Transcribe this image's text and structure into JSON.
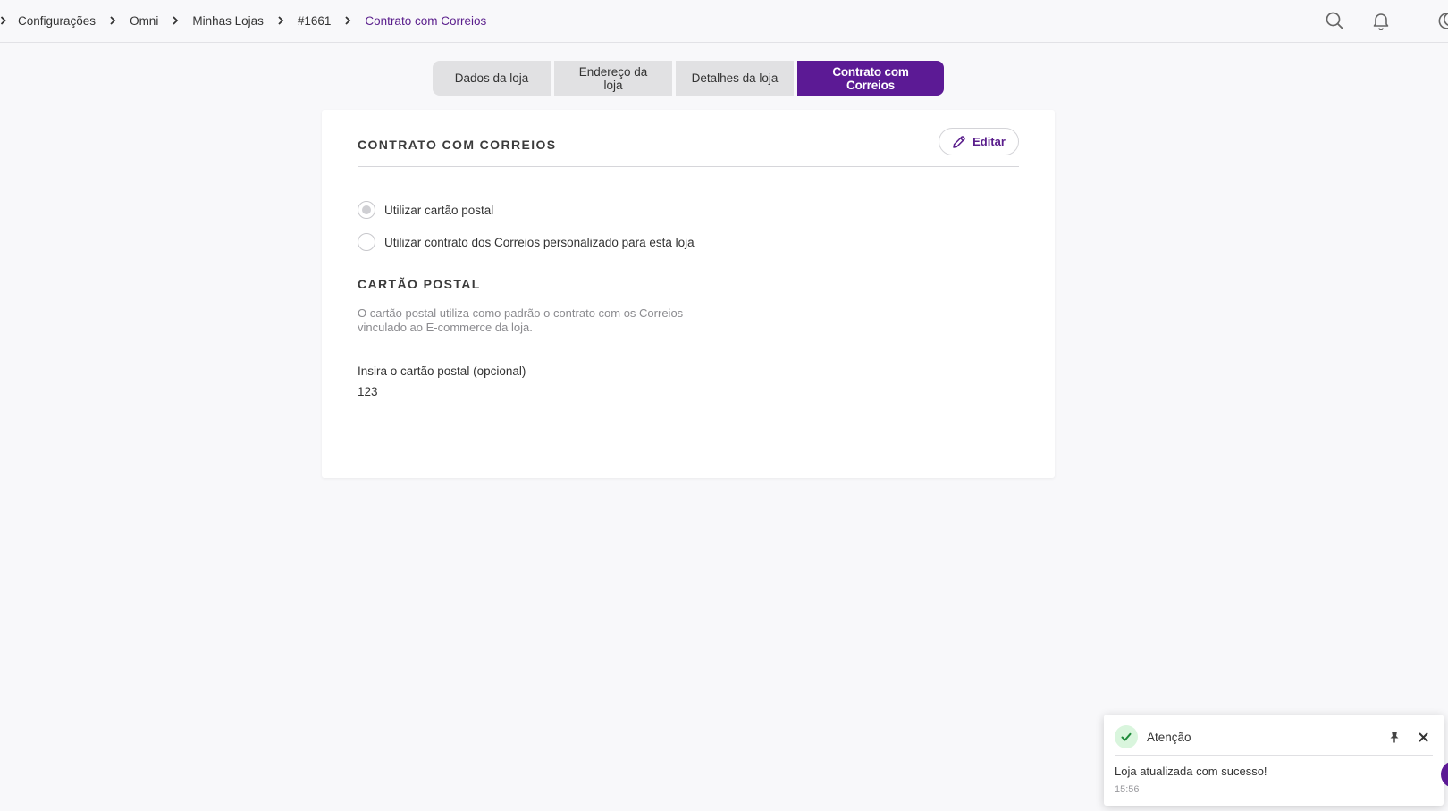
{
  "breadcrumb": {
    "items": [
      {
        "label": "Configurações"
      },
      {
        "label": "Omni"
      },
      {
        "label": "Minhas Lojas"
      },
      {
        "label": "#1661"
      },
      {
        "label": "Contrato com Correios"
      }
    ]
  },
  "header_icons": [
    "search-icon",
    "bell-icon",
    "moon-icon"
  ],
  "tabs": [
    {
      "label": "Dados da loja",
      "active": false
    },
    {
      "label": "Endereço da loja",
      "active": false
    },
    {
      "label": "Detalhes da loja",
      "active": false
    },
    {
      "label": "Contrato com Correios",
      "active": true
    }
  ],
  "card": {
    "title": "CONTRATO COM CORREIOS",
    "edit_label": "Editar",
    "radio_options": [
      {
        "label": "Utilizar cartão postal",
        "selected": true
      },
      {
        "label": "Utilizar contrato dos Correios personalizado para esta loja",
        "selected": false
      }
    ],
    "section_title": "CARTÃO POSTAL",
    "section_desc": "O cartão postal utiliza como padrão o contrato com os Correios vinculado ao E-commerce da loja.",
    "field_label": "Insira o cartão postal (opcional)",
    "field_value": "123"
  },
  "toast": {
    "title": "Atenção",
    "message": "Loja atualizada com sucesso!",
    "time": "15:56"
  },
  "colors": {
    "accent": "#5c1a95",
    "active_crumb": "#5a1e8c",
    "success_bg": "#d9f5dd",
    "success_icon": "#1e8a3a"
  }
}
